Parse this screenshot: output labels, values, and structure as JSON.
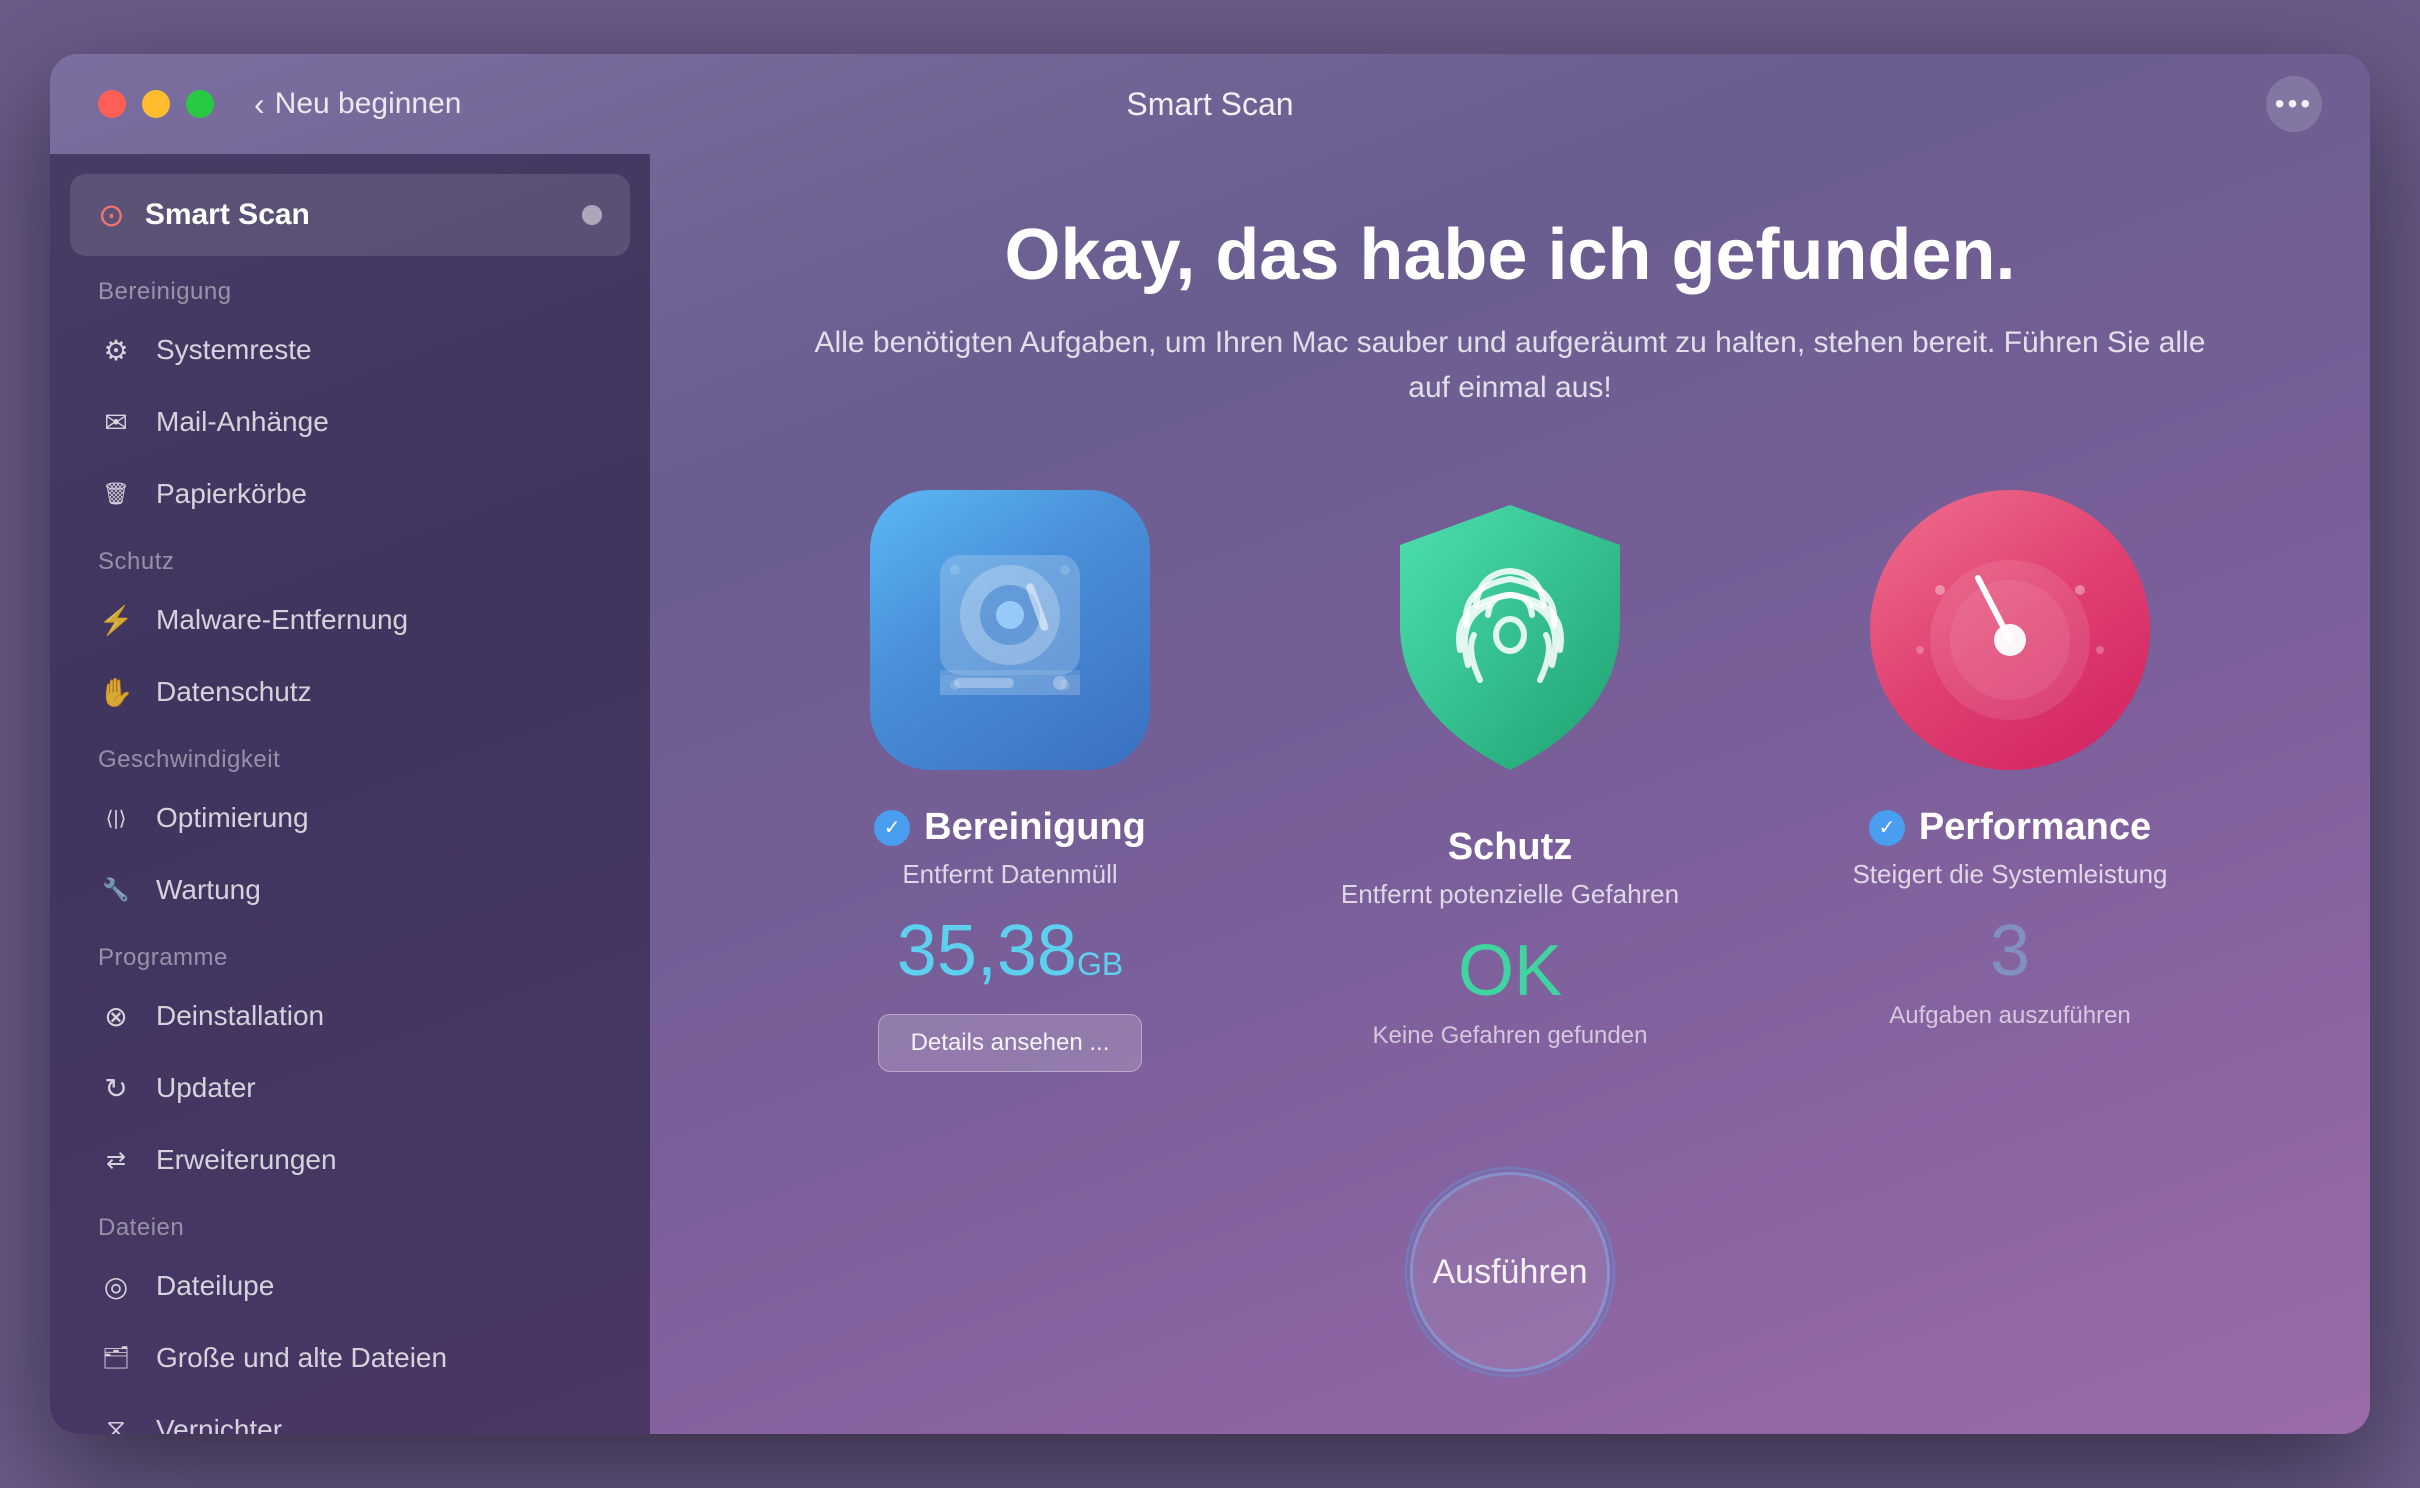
{
  "window": {
    "title": "Smart Scan"
  },
  "titlebar": {
    "back_label": "Neu beginnen",
    "center_label": "Smart Scan",
    "dots_label": "•••"
  },
  "sidebar": {
    "active_item": {
      "label": "Smart Scan"
    },
    "sections": [
      {
        "label": "Bereinigung",
        "items": [
          {
            "id": "systemreste",
            "label": "Systemreste",
            "icon": "system-icon"
          },
          {
            "id": "mail-anhaenge",
            "label": "Mail-Anhänge",
            "icon": "mail-icon"
          },
          {
            "id": "papierkoerbe",
            "label": "Papierkörbe",
            "icon": "trash-icon"
          }
        ]
      },
      {
        "label": "Schutz",
        "items": [
          {
            "id": "malware",
            "label": "Malware-Entfernung",
            "icon": "malware-icon"
          },
          {
            "id": "datenschutz",
            "label": "Datenschutz",
            "icon": "privacy-icon"
          }
        ]
      },
      {
        "label": "Geschwindigkeit",
        "items": [
          {
            "id": "optimierung",
            "label": "Optimierung",
            "icon": "optimize-icon"
          },
          {
            "id": "wartung",
            "label": "Wartung",
            "icon": "maintain-icon"
          }
        ]
      },
      {
        "label": "Programme",
        "items": [
          {
            "id": "deinstallation",
            "label": "Deinstallation",
            "icon": "uninstall-icon"
          },
          {
            "id": "updater",
            "label": "Updater",
            "icon": "updater-icon"
          },
          {
            "id": "erweiterungen",
            "label": "Erweiterungen",
            "icon": "extensions-icon"
          }
        ]
      },
      {
        "label": "Dateien",
        "items": [
          {
            "id": "dateilupe",
            "label": "Dateilupe",
            "icon": "filelens-icon"
          },
          {
            "id": "grosse-dateien",
            "label": "Große und alte Dateien",
            "icon": "largefiles-icon"
          },
          {
            "id": "vernichter",
            "label": "Vernichter",
            "icon": "shredder-icon"
          }
        ]
      }
    ]
  },
  "content": {
    "title": "Okay, das habe ich gefunden.",
    "subtitle": "Alle benötigten Aufgaben, um Ihren Mac sauber und aufgeräumt zu halten, stehen bereit. Führen Sie alle auf einmal aus!",
    "cards": [
      {
        "id": "cleaning",
        "name": "Bereinigung",
        "desc": "Entfernt Datenmüll",
        "value": "35,38",
        "unit": "GB",
        "sub": "",
        "details_btn": "Details ansehen ...",
        "has_check": true,
        "color": "cleaning"
      },
      {
        "id": "protection",
        "name": "Schutz",
        "desc": "Entfernt potenzielle Gefahren",
        "value": "OK",
        "unit": "",
        "sub": "Keine Gefahren gefunden",
        "details_btn": "",
        "has_check": false,
        "color": "protection"
      },
      {
        "id": "performance",
        "name": "Performance",
        "desc": "Steigert die Systemleistung",
        "value": "3",
        "unit": "",
        "sub": "Aufgaben auszuführen",
        "details_btn": "",
        "has_check": true,
        "color": "performance"
      }
    ],
    "execute_btn_label": "Ausführen"
  }
}
